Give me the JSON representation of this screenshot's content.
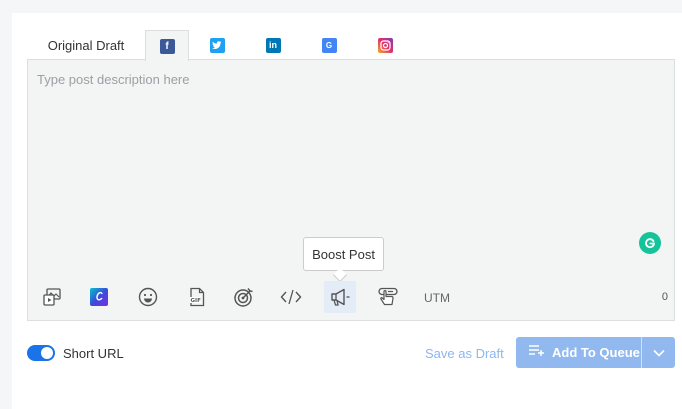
{
  "tabs": [
    {
      "label": "Original Draft"
    },
    {
      "icon": "facebook-icon",
      "color": "#3b5998",
      "active": true
    },
    {
      "icon": "twitter-icon",
      "color": "#1da1f2"
    },
    {
      "icon": "linkedin-icon",
      "color": "#0077b5"
    },
    {
      "icon": "google-business-icon",
      "color": "#4285f4"
    },
    {
      "icon": "instagram-icon",
      "color": "#e1306c"
    }
  ],
  "editor": {
    "placeholder": "Type post description here",
    "char_count": "0"
  },
  "tooltip": {
    "text": "Boost Post"
  },
  "toolbar": {
    "utm_label": "UTM",
    "tools": [
      "media-library-icon",
      "canva-icon",
      "emoji-icon",
      "gif-icon",
      "targeting-icon",
      "embed-code-icon",
      "boost-post-icon",
      "first-comment-icon"
    ]
  },
  "footer": {
    "short_url_label": "Short URL",
    "short_url_enabled": true,
    "save_draft_label": "Save as Draft",
    "add_queue_label": "Add To Queue"
  },
  "colors": {
    "accent": "#1a73e8",
    "queue_button": "#92b9ef",
    "grammarly": "#15c39a"
  }
}
